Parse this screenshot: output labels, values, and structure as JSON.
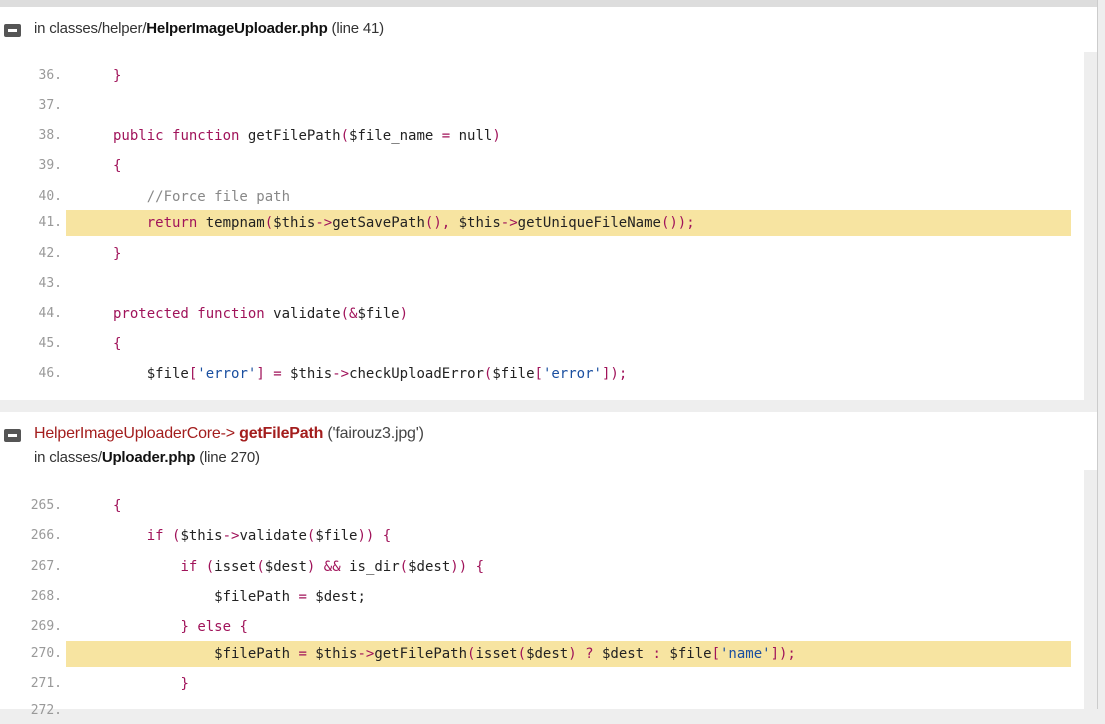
{
  "frame1": {
    "file_prefix": "in classes/helper/",
    "file_name": "HelperImageUploader.php",
    "line_info": " (line 41)",
    "lines": [
      {
        "num": "36.",
        "code": "}"
      },
      {
        "num": "37.",
        "code": ""
      },
      {
        "num": "38.",
        "code": "public function getFilePath($file_name = null)"
      },
      {
        "num": "39.",
        "code": "{"
      },
      {
        "num": "40.",
        "code": "    //Force file path"
      },
      {
        "num": "41.",
        "code": "    return tempnam($this->getSavePath(), $this->getUniqueFileName());"
      },
      {
        "num": "42.",
        "code": "}"
      },
      {
        "num": "43.",
        "code": ""
      },
      {
        "num": "44.",
        "code": "protected function validate(&$file)"
      },
      {
        "num": "45.",
        "code": "{"
      },
      {
        "num": "46.",
        "code": "    $file['error'] = $this->checkUploadError($file['error']);"
      }
    ]
  },
  "frame2": {
    "class_name": "HelperImageUploaderCore-> ",
    "method_name": "getFilePath",
    "args": " ('fairouz3.jpg')",
    "file_prefix": "in classes/",
    "file_name": "Uploader.php",
    "line_info": " (line 270)",
    "lines": [
      {
        "num": "265.",
        "code": "{"
      },
      {
        "num": "266.",
        "code": "    if ($this->validate($file)) {"
      },
      {
        "num": "267.",
        "code": "        if (isset($dest) && is_dir($dest)) {"
      },
      {
        "num": "268.",
        "code": "            $filePath = $dest;"
      },
      {
        "num": "269.",
        "code": "        } else {"
      },
      {
        "num": "270.",
        "code": "            $filePath = $this->getFilePath(isset($dest) ? $dest : $file['name']);"
      },
      {
        "num": "271.",
        "code": "        }"
      },
      {
        "num": "272.",
        "code": ""
      }
    ]
  }
}
